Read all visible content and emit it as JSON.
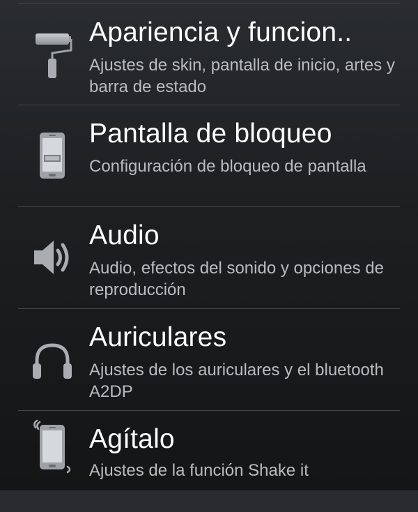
{
  "settings": {
    "items": [
      {
        "title": "Apariencia y funcion..",
        "subtitle": "Ajustes de skin, pantalla de inicio, artes y barra de estado",
        "icon": "paint-roller-icon"
      },
      {
        "title": "Pantalla de bloqueo",
        "subtitle": "Configuración de bloqueo de pantalla",
        "icon": "phone-lock-icon"
      },
      {
        "title": "Audio",
        "subtitle": "Audio, efectos del sonido y opciones de reproducción",
        "icon": "speaker-icon"
      },
      {
        "title": "Auriculares",
        "subtitle": "Ajustes de los auriculares y el bluetooth A2DP",
        "icon": "headphones-icon"
      },
      {
        "title": "Agítalo",
        "subtitle": "Ajustes de la función Shake it",
        "icon": "shake-phone-icon"
      }
    ]
  },
  "colors": {
    "background": "#1d1f21",
    "divider": "#45484b",
    "title": "#ffffff",
    "subtitle": "#b9bcbf",
    "icon": "#a9adb1"
  }
}
